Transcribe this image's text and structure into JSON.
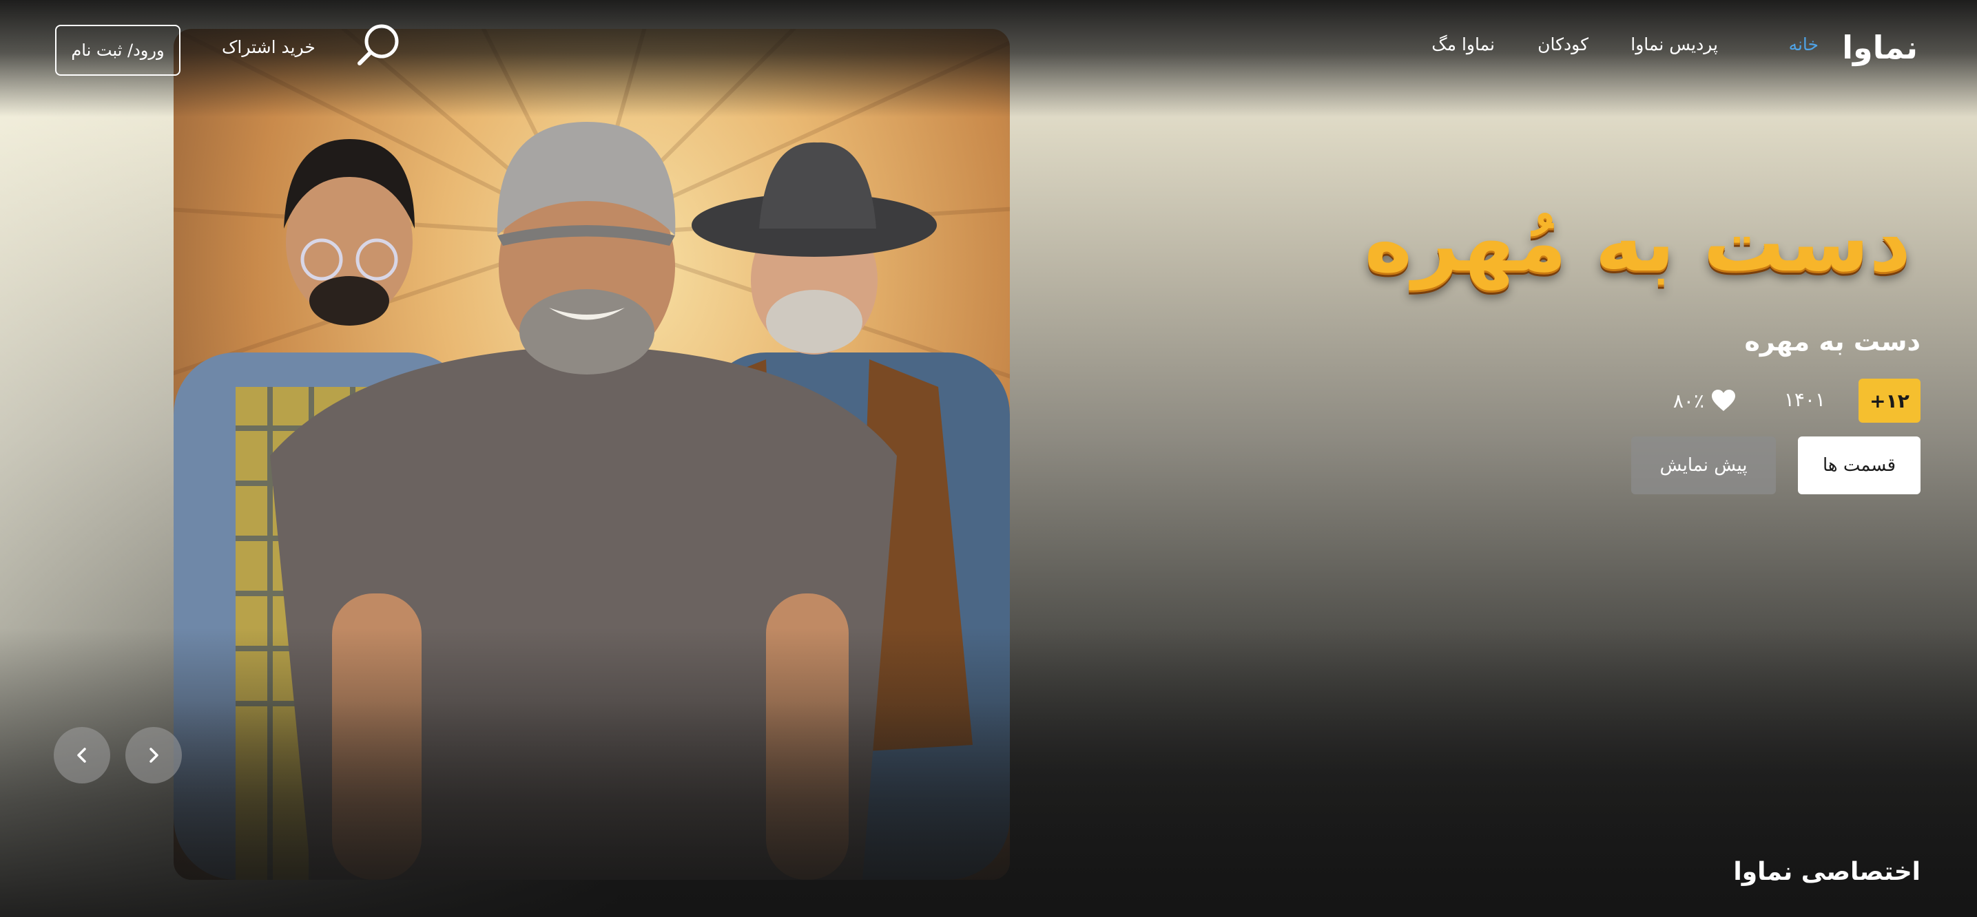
{
  "header": {
    "logo": "نماوا",
    "nav": [
      {
        "label": "خانه",
        "active": true
      },
      {
        "label": "پردیس نماوا",
        "active": false
      },
      {
        "label": "کودکان",
        "active": false
      },
      {
        "label": "نماوا مگ",
        "active": false
      }
    ],
    "subscribe_label": "خرید اشتراک",
    "login_label": "ورود/ ثبت نام",
    "search_icon": "search-icon"
  },
  "hero": {
    "title_art": "دست به مُهره",
    "title": "دست به مهره",
    "age_rating": "+۱۲",
    "year": "۱۴۰۱",
    "like_percent": "۸۰٪",
    "episodes_button": "قسمت ها",
    "preview_button": "پیش نمایش"
  },
  "carousel": {
    "prev_icon": "chevron-left-icon",
    "next_icon": "chevron-right-icon"
  },
  "sections": {
    "exclusive_title": "اختصاصی نماوا"
  },
  "colors": {
    "accent": "#4fa3e6",
    "badge": "#f5bf2f",
    "title_art": "#f7b52a"
  }
}
